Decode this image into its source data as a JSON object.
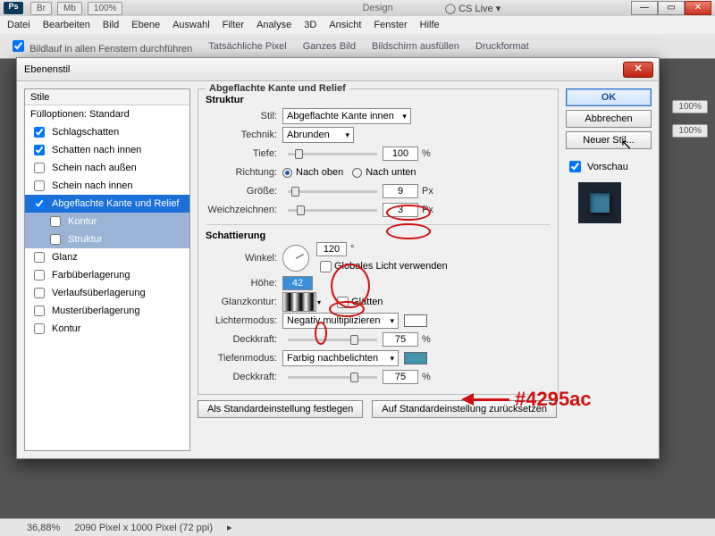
{
  "app": {
    "design_label": "Design",
    "cslive": "CS Live"
  },
  "menu": [
    "Datei",
    "Bearbeiten",
    "Bild",
    "Ebene",
    "Auswahl",
    "Filter",
    "Analyse",
    "3D",
    "Ansicht",
    "Fenster",
    "Hilfe"
  ],
  "opts": {
    "scroll_all": "Bildlauf in allen Fenstern durchführen",
    "actual": "Tatsächliche Pixel",
    "fit": "Ganzes Bild",
    "fill": "Bildschirm ausfüllen",
    "print": "Druckformat",
    "zoom_pct": "100%"
  },
  "dialog": {
    "title": "Ebenenstil",
    "styles_header": "Stile",
    "blend_opts": "Fülloptionen: Standard",
    "items": [
      {
        "label": "Schlagschatten",
        "checked": true
      },
      {
        "label": "Schatten nach innen",
        "checked": true
      },
      {
        "label": "Schein nach außen",
        "checked": false
      },
      {
        "label": "Schein nach innen",
        "checked": false
      },
      {
        "label": "Abgeflachte Kante und Relief",
        "checked": true,
        "selected": true
      },
      {
        "label": "Kontur",
        "sub": true
      },
      {
        "label": "Struktur",
        "sub": true
      },
      {
        "label": "Glanz",
        "checked": false
      },
      {
        "label": "Farbüberlagerung",
        "checked": false
      },
      {
        "label": "Verlaufsüberlagerung",
        "checked": false
      },
      {
        "label": "Musterüberlagerung",
        "checked": false
      },
      {
        "label": "Kontur",
        "checked": false
      }
    ],
    "group_title": "Abgeflachte Kante und Relief",
    "structure": {
      "legend": "Struktur",
      "stil_label": "Stil:",
      "stil_value": "Abgeflachte Kante innen",
      "technik_label": "Technik:",
      "technik_value": "Abrunden",
      "tiefe_label": "Tiefe:",
      "tiefe_value": "100",
      "tiefe_unit": "%",
      "richtung_label": "Richtung:",
      "richtung_up": "Nach oben",
      "richtung_down": "Nach unten",
      "groesse_label": "Größe:",
      "groesse_value": "9",
      "groesse_unit": "Px",
      "weich_label": "Weichzeichnen:",
      "weich_value": "3",
      "weich_unit": "Px"
    },
    "shading": {
      "legend": "Schattierung",
      "winkel_label": "Winkel:",
      "winkel_value": "120",
      "winkel_unit": "°",
      "global_light": "Globales Licht verwenden",
      "hoehe_label": "Höhe:",
      "hoehe_value": "42",
      "gloss_label": "Glanzkontur:",
      "glaetten": "Glätten",
      "lichter_label": "Lichtermodus:",
      "lichter_value": "Negativ multiplizieren",
      "deck_label": "Deckkraft:",
      "deck1_value": "75",
      "deck_unit": "%",
      "tiefen_label": "Tiefenmodus:",
      "tiefen_value": "Farbig nachbelichten",
      "tiefen_color": "#4295ac",
      "deck2_value": "75"
    },
    "make_default": "Als Standardeinstellung festlegen",
    "reset_default": "Auf Standardeinstellung zurücksetzen",
    "ok": "OK",
    "cancel": "Abbrechen",
    "newstyle": "Neuer Stil...",
    "preview": "Vorschau"
  },
  "annotation": {
    "color_label": "#4295ac"
  },
  "status": {
    "zoom": "36,88%",
    "docinfo": "2090 Pixel x 1000 Pixel (72 ppi)"
  },
  "panel": {
    "pct": "100%"
  }
}
